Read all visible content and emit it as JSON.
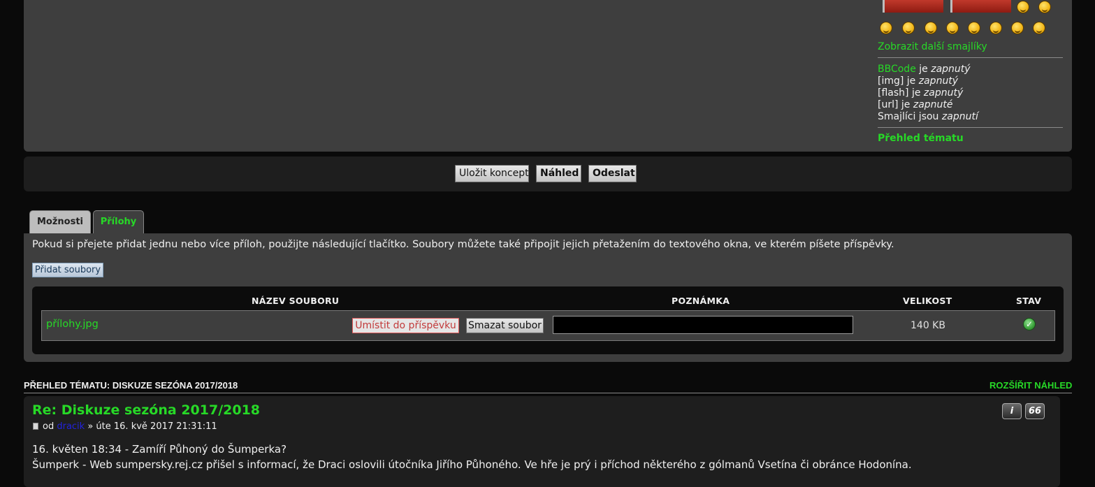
{
  "sidebar": {
    "more_smilies": "Zobrazit další smajlíky",
    "bbcode_link": "BBCode",
    "bbcode_suffix": " je ",
    "bbcode_state": "zapnutý",
    "img_label": "[img] je ",
    "img_state": "zapnutý",
    "flash_label": "[flash] je ",
    "flash_state": "zapnutý",
    "url_label": "[url] je ",
    "url_state": "zapnuté",
    "smilies_label": "Smajlíci jsou ",
    "smilies_state": "zapnutí",
    "topic_overview": "Přehled tématu"
  },
  "actions": {
    "save_draft": "Uložit koncept",
    "preview": "Náhled",
    "submit": "Odeslat"
  },
  "tabs": {
    "options": "Možnosti",
    "attachments": "Přílohy"
  },
  "attachments": {
    "intro": "Pokud si přejete přidat jednu nebo více příloh, použijte následující tlačítko. Soubory můžete také připojit jejich přetažením do textového okna, ve kterém píšete příspěvky.",
    "add_files": "Přidat soubory",
    "headers": {
      "filename": "NÁZEV SOUBORU",
      "note": "POZNÁMKA",
      "size": "VELIKOST",
      "status": "STAV"
    },
    "file": {
      "name": "přílohy.jpg",
      "place_in_post": "Umístit do příspěvku",
      "delete": "Smazat soubor",
      "note_value": "",
      "size": "140 KB",
      "status_icon": "check-circle-icon"
    }
  },
  "topic_review": {
    "title": "PŘEHLED TÉMATU: DISKUZE SEZÓNA 2017/2018",
    "expand": "ROZŠÍŘIT NÁHLED",
    "post": {
      "title": "Re: Diskuze sezóna 2017/2018",
      "by": "od ",
      "author": "dracik",
      "date": " » úte 16. kvě 2017 21:31:11",
      "line1": "16. květen 18:34 - Zamíří Půhoný do Šumperka?",
      "line2": "Šumperk - Web sumpersky.rej.cz přišel s informací, že Draci oslovili útočníka Jiřího Půhoného. Ve hře je prý i příchod některého z gólmanů Vsetína či obránce Hodonína.",
      "info_tool": "i",
      "quote_tool": "66"
    }
  },
  "colors": {
    "accent_green": "#27d927",
    "panel_bg": "#3e3e3e",
    "page_bg": "#0a0a0a"
  }
}
